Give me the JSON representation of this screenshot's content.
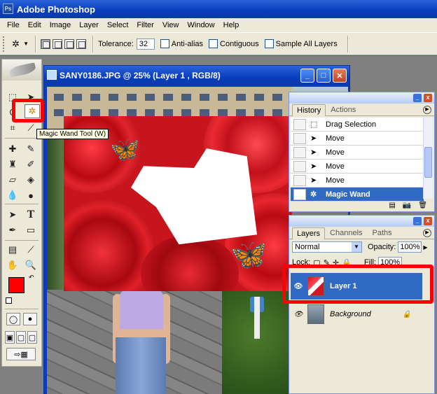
{
  "app": {
    "title": "Adobe Photoshop"
  },
  "menu": [
    "File",
    "Edit",
    "Image",
    "Layer",
    "Select",
    "Filter",
    "View",
    "Window",
    "Help"
  ],
  "options": {
    "tool_icon": "magic-wand-icon",
    "tolerance_label": "Tolerance:",
    "tolerance_value": "32",
    "anti_alias": "Anti-alias",
    "contiguous": "Contiguous",
    "sample_all": "Sample All Layers"
  },
  "toolbox": {
    "tooltip": "Magic Wand Tool (W)",
    "fg_color": "#ff0000",
    "bg_color": "#000000"
  },
  "document": {
    "title": "SANY0186.JPG @ 25% (Layer 1 , RGB/8)",
    "min": "_",
    "max": "□",
    "close": "✕"
  },
  "history": {
    "tabs": [
      "History",
      "Actions"
    ],
    "items": [
      {
        "label": "Drag Selection",
        "icon": "marquee-icon"
      },
      {
        "label": "Move",
        "icon": "move-icon"
      },
      {
        "label": "Move",
        "icon": "move-icon"
      },
      {
        "label": "Move",
        "icon": "move-icon"
      },
      {
        "label": "Move",
        "icon": "move-icon"
      },
      {
        "label": "Magic Wand",
        "icon": "magic-wand-icon"
      }
    ]
  },
  "layers": {
    "tabs": [
      "Layers",
      "Channels",
      "Paths"
    ],
    "blend_mode": "Normal",
    "opacity_label": "Opacity:",
    "opacity_value": "100%",
    "lock_label": "Lock:",
    "fill_label": "Fill:",
    "fill_value": "100%",
    "items": [
      {
        "name": "Layer 1"
      },
      {
        "name": "Background"
      }
    ]
  },
  "colors": {
    "accent": "#316ac5",
    "highlight": "#ff0000",
    "title_bar": "#0a3dbd"
  }
}
